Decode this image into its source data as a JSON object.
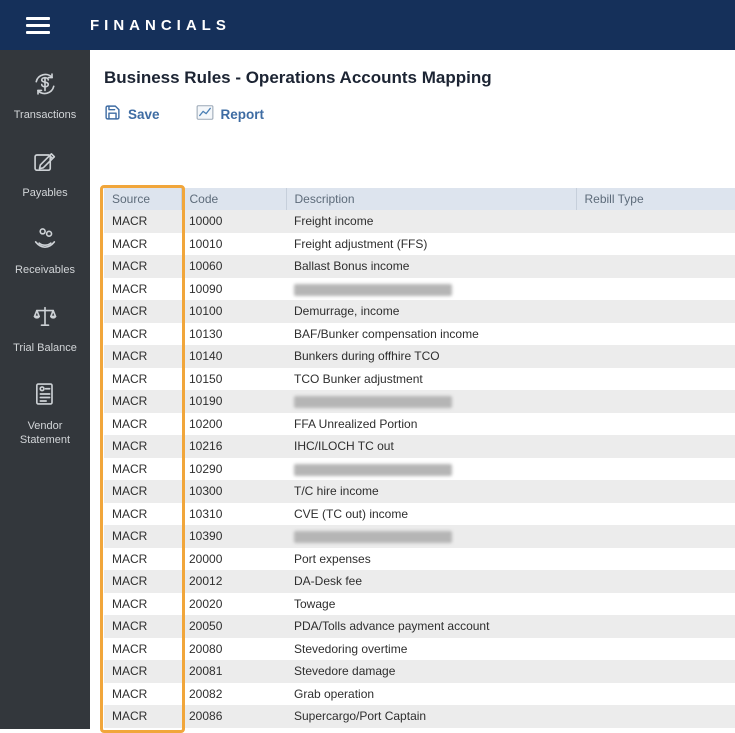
{
  "topbar": {
    "title": "FINANCIALS"
  },
  "sidebar": {
    "items": [
      {
        "label": "Transactions",
        "icon": "transactions-icon"
      },
      {
        "label": "Payables",
        "icon": "payables-icon"
      },
      {
        "label": "Receivables",
        "icon": "receivables-icon"
      },
      {
        "label": "Trial Balance",
        "icon": "trial-balance-icon"
      },
      {
        "label": "Vendor Statement",
        "icon": "vendor-statement-icon"
      }
    ]
  },
  "main": {
    "title": "Business Rules - Operations Accounts Mapping",
    "toolbar": {
      "save_label": "Save",
      "report_label": "Report"
    }
  },
  "table": {
    "columns": [
      "Source",
      "Code",
      "Description",
      "Rebill Type"
    ],
    "rows": [
      {
        "source": "MACR",
        "code": "10000",
        "description": "Freight income",
        "rebill": "",
        "redacted": false
      },
      {
        "source": "MACR",
        "code": "10010",
        "description": "Freight adjustment (FFS)",
        "rebill": "",
        "redacted": false
      },
      {
        "source": "MACR",
        "code": "10060",
        "description": "Ballast Bonus income",
        "rebill": "",
        "redacted": false
      },
      {
        "source": "MACR",
        "code": "10090",
        "description": "",
        "rebill": "",
        "redacted": true
      },
      {
        "source": "MACR",
        "code": "10100",
        "description": "Demurrage, income",
        "rebill": "",
        "redacted": false
      },
      {
        "source": "MACR",
        "code": "10130",
        "description": "BAF/Bunker compensation income",
        "rebill": "",
        "redacted": false
      },
      {
        "source": "MACR",
        "code": "10140",
        "description": "Bunkers during offhire TCO",
        "rebill": "",
        "redacted": false
      },
      {
        "source": "MACR",
        "code": "10150",
        "description": "TCO Bunker adjustment",
        "rebill": "",
        "redacted": false
      },
      {
        "source": "MACR",
        "code": "10190",
        "description": "",
        "rebill": "",
        "redacted": true
      },
      {
        "source": "MACR",
        "code": "10200",
        "description": "FFA Unrealized Portion",
        "rebill": "",
        "redacted": false
      },
      {
        "source": "MACR",
        "code": "10216",
        "description": "IHC/ILOCH TC out",
        "rebill": "",
        "redacted": false
      },
      {
        "source": "MACR",
        "code": "10290",
        "description": "",
        "rebill": "",
        "redacted": true
      },
      {
        "source": "MACR",
        "code": "10300",
        "description": "T/C hire income",
        "rebill": "",
        "redacted": false
      },
      {
        "source": "MACR",
        "code": "10310",
        "description": "CVE (TC out) income",
        "rebill": "",
        "redacted": false
      },
      {
        "source": "MACR",
        "code": "10390",
        "description": "",
        "rebill": "",
        "redacted": true
      },
      {
        "source": "MACR",
        "code": "20000",
        "description": "Port expenses",
        "rebill": "",
        "redacted": false
      },
      {
        "source": "MACR",
        "code": "20012",
        "description": "DA-Desk fee",
        "rebill": "",
        "redacted": false
      },
      {
        "source": "MACR",
        "code": "20020",
        "description": "Towage",
        "rebill": "",
        "redacted": false
      },
      {
        "source": "MACR",
        "code": "20050",
        "description": "PDA/Tolls advance payment account",
        "rebill": "",
        "redacted": false
      },
      {
        "source": "MACR",
        "code": "20080",
        "description": "Stevedoring overtime",
        "rebill": "",
        "redacted": false
      },
      {
        "source": "MACR",
        "code": "20081",
        "description": "Stevedore damage",
        "rebill": "",
        "redacted": false
      },
      {
        "source": "MACR",
        "code": "20082",
        "description": "Grab operation",
        "rebill": "",
        "redacted": false
      },
      {
        "source": "MACR",
        "code": "20086",
        "description": "Supercargo/Port Captain",
        "rebill": "",
        "redacted": false
      }
    ]
  },
  "annotation": {
    "highlighted_column": "Source",
    "highlight_color": "#f1a63b"
  },
  "colors": {
    "topbar_bg": "#15305a",
    "sidebar_bg": "#33373c",
    "accent_blue": "#3e6ca3",
    "table_header_bg": "#dde4ee",
    "row_alt_bg": "#ececec"
  }
}
